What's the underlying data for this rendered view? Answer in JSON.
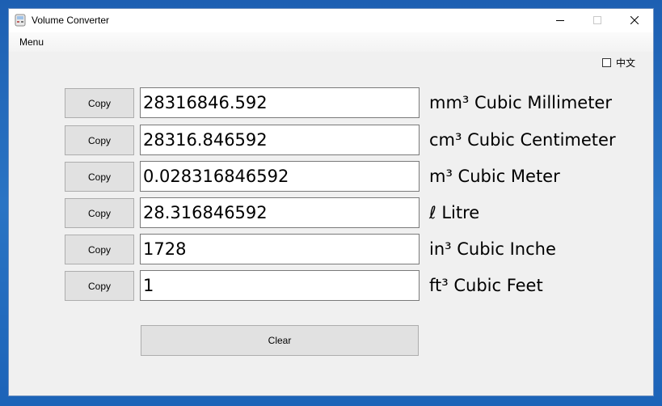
{
  "window": {
    "title": "Volume Converter",
    "controls": [
      "minimize",
      "maximize",
      "close"
    ]
  },
  "menu": {
    "label": "Menu"
  },
  "language": {
    "label": "中文",
    "checked": false
  },
  "rows": [
    {
      "copy_label": "Copy",
      "value": "28316846.592",
      "unit": "mm³ Cubic Millimeter"
    },
    {
      "copy_label": "Copy",
      "value": "28316.846592",
      "unit": "cm³ Cubic Centimeter"
    },
    {
      "copy_label": "Copy",
      "value": "0.028316846592",
      "unit": "m³ Cubic Meter"
    },
    {
      "copy_label": "Copy",
      "value": "28.316846592",
      "unit": "ℓ Litre"
    },
    {
      "copy_label": "Copy",
      "value": "1728",
      "unit": "in³ Cubic Inche"
    },
    {
      "copy_label": "Copy",
      "value": "1",
      "unit": "ft³ Cubic Feet"
    }
  ],
  "clear_label": "Clear",
  "icons": {
    "app": "app-icon",
    "minimize": "minimize-icon",
    "maximize": "maximize-icon",
    "close": "close-icon"
  }
}
